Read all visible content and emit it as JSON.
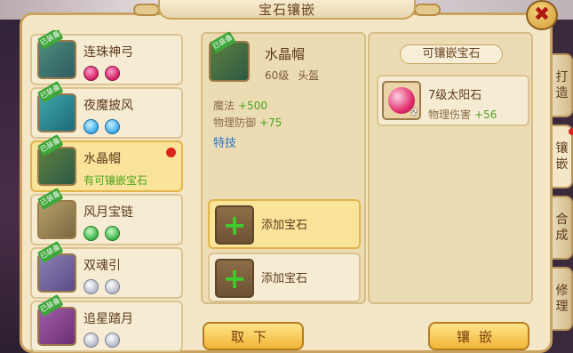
{
  "window": {
    "title": "宝石镶嵌",
    "close_label": "✖"
  },
  "equipment_list": [
    {
      "name": "连珠神弓",
      "equipped_badge": "已装备",
      "gems": [
        "red",
        "red"
      ],
      "selected": false
    },
    {
      "name": "夜魔披风",
      "equipped_badge": "已装备",
      "gems": [
        "blue",
        "blue"
      ],
      "selected": false
    },
    {
      "name": "水晶帽",
      "equipped_badge": "已装备",
      "subtitle": "有可镶嵌宝石",
      "selected": true,
      "alert": true
    },
    {
      "name": "风月宝链",
      "equipped_badge": "已装备",
      "gems": [
        "green",
        "green"
      ],
      "selected": false
    },
    {
      "name": "双魂引",
      "equipped_badge": "已装备",
      "gems": [
        "white",
        "white"
      ],
      "selected": false
    },
    {
      "name": "追星踏月",
      "equipped_badge": "已装备",
      "gems": [
        "white",
        "white"
      ],
      "selected": false
    }
  ],
  "detail": {
    "equipped_badge": "已装备",
    "name": "水晶帽",
    "level": "60级",
    "slot": "头盔",
    "stats": [
      {
        "label": "魔法",
        "value": "+500"
      },
      {
        "label": "物理防御",
        "value": "+75"
      }
    ],
    "skill_label": "特技",
    "add_slots": [
      {
        "label": "添加宝石",
        "highlighted": true
      },
      {
        "label": "添加宝石",
        "highlighted": false
      }
    ]
  },
  "gem_panel": {
    "header": "可镶嵌宝石",
    "gems": [
      {
        "name": "7级太阳石",
        "effect_label": "物理伤害",
        "effect_value": "+56",
        "icon_level": "2"
      }
    ]
  },
  "buttons": {
    "remove": "取下",
    "inlay": "镶嵌"
  },
  "side_tabs": [
    {
      "label": "打造",
      "active": false
    },
    {
      "label": "镶嵌",
      "active": true
    },
    {
      "label": "合成",
      "active": false
    },
    {
      "label": "修理",
      "active": false
    }
  ],
  "colors": {
    "panel": "#f4e7c7",
    "border": "#c9a35f",
    "selected": "#f9e49a",
    "positive": "#4aa31f",
    "skill": "#2a73c6",
    "alert": "#d9231b"
  }
}
